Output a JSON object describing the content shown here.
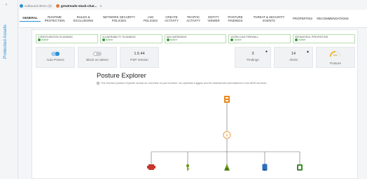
{
  "rail": {
    "label": "Protected Assets"
  },
  "breadcrumbs": [
    {
      "label": "cutbound-demo (3)",
      "color": "#2a8fd6",
      "active": false
    },
    {
      "label": "greatreads-stack-char...",
      "color": "#e07b39",
      "active": true
    }
  ],
  "tabs": [
    {
      "label": "GENERAL",
      "active": true
    },
    {
      "label": "RUNTIME PROTECTION"
    },
    {
      "label": "RULES & EXCLUSIONS"
    },
    {
      "label": "NETWORK SECURITY POLICIES"
    },
    {
      "label": "IAM POLICIES"
    },
    {
      "label": "CREATE ACTIVITY"
    },
    {
      "label": "TRAFFIC ACTIVITY"
    },
    {
      "label": "ENTITY VIEWER"
    },
    {
      "label": "POSTURE FINDINGS"
    },
    {
      "label": "THREAT & SECURITY EVENTS"
    },
    {
      "label": "PROPERTIES"
    },
    {
      "label": "RECOMMENDATIONS"
    }
  ],
  "status": [
    {
      "title": "CONFIGURATION SCANNING",
      "state": "Active"
    },
    {
      "title": "VULNERABILITY SCANNING",
      "state": "Active"
    },
    {
      "title": "IAM HARDENING",
      "state": "Active"
    },
    {
      "title": "WORKLOAD FIREWALL",
      "state": "Active"
    },
    {
      "title": "BEHAVIORAL PREVENTION",
      "state": "Active"
    }
  ],
  "cards": {
    "auto_protect": {
      "label": "Auto Protect",
      "on": true
    },
    "block_on_detect": {
      "label": "Block on detect",
      "on": false
    },
    "psp": {
      "value": "1.5.44",
      "label": "PSP Version"
    },
    "findings": {
      "value": "3",
      "label": "Findings"
    },
    "alerts": {
      "value": "14",
      "label": "Alerts"
    },
    "posture": {
      "value": "50%",
      "label": "Posture",
      "level": 0.5
    }
  },
  "explorer": {
    "title": "Posture Explorer",
    "description": "The function posture explorer shows an overview of your function, its upstream triggers and its downstream permissions to the AWS services."
  },
  "colors": {
    "accent": "#2a8fd6",
    "active": "#3c9a3c",
    "lambda": "#e8891e",
    "red": "#c7352b",
    "green": "#6a9a22",
    "blue": "#2a6fc0",
    "dark_green": "#3f8a2e"
  }
}
